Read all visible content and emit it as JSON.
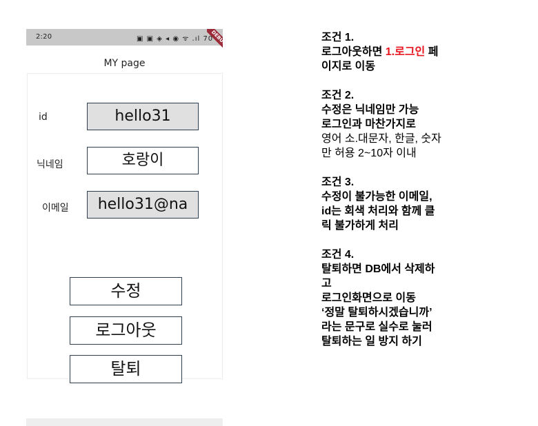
{
  "phone": {
    "status_bar": {
      "time": "2:20",
      "icons": "▣ ▣ ◈ ◂ ◉ ᯤ .ıl 70",
      "debug_banner": "DEBUG"
    },
    "app_title": "MY page",
    "fields": [
      {
        "label": "id",
        "value": "hello31",
        "editable": false
      },
      {
        "label": "닉네임",
        "value": "호랑이",
        "editable": true
      },
      {
        "label": "이메일",
        "value": "hello31@na",
        "editable": false
      }
    ],
    "buttons": {
      "edit": "수정",
      "logout": "로그아웃",
      "withdraw": "탈퇴"
    }
  },
  "notes": {
    "cond1": {
      "title": "조건 1.",
      "line1_pre": "로그아웃하면 ",
      "line1_red": "1.로그인",
      "line1_post": " 페",
      "line2": "이지로 이동"
    },
    "cond2": {
      "title": "조건 2.",
      "line1": "수정은 닉네임만 가능",
      "line2": "로그인과 마찬가지로",
      "line3": "영어 소.대문자, 한글, 숫자",
      "line4": "만 허용 2~10자 이내"
    },
    "cond3": {
      "title": "조건 3.",
      "line1": "수정이 불가능한 이메일,",
      "line2": "id는 회색 처리와 함께 클",
      "line3": "릭 불가하게 처리"
    },
    "cond4": {
      "title": "조건 4.",
      "line1": "탈퇴하면 DB에서 삭제하",
      "line2": "고",
      "line3": "로그인화면으로 이동",
      "line4": "‘정말 탈퇴하시겠습니까’",
      "line5": "라는 문구로 실수로 눌러",
      "line6": "탈퇴하는 일 방지 하기"
    }
  },
  "colors": {
    "accent_red": "#e8141c",
    "disabled_field_bg": "#e0e0e0",
    "field_border": "#2c3e50",
    "status_bar_bg": "#c8c8c8"
  }
}
